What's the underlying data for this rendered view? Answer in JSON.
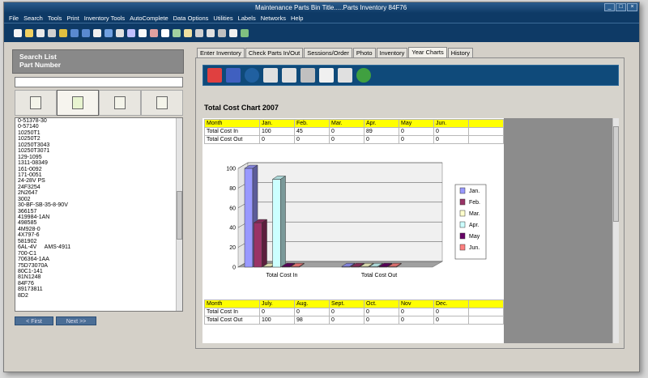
{
  "window": {
    "title": "Maintenance Parts Bin      Title.....Parts Inventory  84F76"
  },
  "menu": [
    "File",
    "Search",
    "Tools",
    "Print",
    "Inventory Tools",
    "AutoComplete",
    "Data Options",
    "Utilities",
    "Labels",
    "Networks",
    "Help"
  ],
  "toolbar_icons": [
    "new-icon",
    "open-icon",
    "save-icon",
    "print-icon",
    "edit-icon",
    "arrow-left-icon",
    "arrow-right-icon",
    "arrow-up-icon",
    "refresh-icon",
    "back-icon",
    "copy-icon",
    "paste-icon",
    "spell-icon",
    "search-icon",
    "link-icon",
    "notes-icon",
    "calendar-icon",
    "tools-icon",
    "settings-icon",
    "image-icon",
    "grid-icon"
  ],
  "search_list": {
    "title_line1": "Search List",
    "title_line2": "Part Number",
    "input_value": "",
    "button_icons": [
      "checklist-icon",
      "note-icon",
      "folder-icon",
      "hand-doc-icon"
    ],
    "items": [
      "0-51378-30",
      "0-57140",
      "10250T1",
      "10250T2",
      "10250T3043",
      "10250T3071",
      "129-1095",
      "1311-08349",
      "161-0092",
      "171-0051",
      "24-28V PS",
      "24F3254",
      "2N2647",
      "3002",
      "30-BF-SB-35-8-90V",
      "366157",
      "419984-1AN",
      "498585",
      "4M928-0",
      "4X797-6",
      "581902",
      "6AL-4V     AMS-4911",
      "700-C1",
      "706364-1AA",
      "75D73070A",
      "80C1-141",
      "81N1248",
      "84F76",
      "89173811",
      "8D2"
    ],
    "first_label": "< First",
    "next_label": "Next >>"
  },
  "tabs": [
    "Enter Inventory",
    "Check Parts In/Out",
    "Sessions/Order",
    "Photo",
    "Inventory",
    "Year Charts",
    "History"
  ],
  "active_tab": "Year Charts",
  "chart_toolbar_icons": [
    "bar-chart-color-icon",
    "bar-chart-blue-icon",
    "globe-icon",
    "pdf-icon",
    "recycle-icon",
    "eraser-icon",
    "email-icon",
    "printer-icon",
    "help-icon"
  ],
  "section_title": "Total Cost Chart  2007",
  "table_top": {
    "header": [
      "Month",
      "Jan.",
      "Feb.",
      "Mar.",
      "Apr.",
      "May",
      "Jun.",
      ""
    ],
    "rows": [
      [
        "Total Cost In",
        "100",
        "45",
        "0",
        "89",
        "0",
        "0",
        ""
      ],
      [
        "Total Cost Out",
        "0",
        "0",
        "0",
        "0",
        "0",
        "0",
        ""
      ]
    ]
  },
  "table_bottom": {
    "header": [
      "Month",
      "July.",
      "Aug.",
      "Sept.",
      "Oct.",
      "Nov",
      "Dec.",
      ""
    ],
    "rows": [
      [
        "Total Cost In",
        "0",
        "0",
        "0",
        "0",
        "0",
        "0",
        ""
      ],
      [
        "Total Cost Out",
        "100",
        "98",
        "0",
        "0",
        "0",
        "0",
        ""
      ]
    ]
  },
  "chart_data": {
    "type": "bar",
    "categories": [
      "Total Cost In",
      "Total Cost Out"
    ],
    "series": [
      {
        "name": "Jan.",
        "values": [
          100,
          0
        ],
        "color": "#9999ff"
      },
      {
        "name": "Feb.",
        "values": [
          45,
          0
        ],
        "color": "#993366"
      },
      {
        "name": "Mar.",
        "values": [
          0,
          0
        ],
        "color": "#ffffcc"
      },
      {
        "name": "Apr.",
        "values": [
          89,
          0
        ],
        "color": "#ccffff"
      },
      {
        "name": "May",
        "values": [
          0,
          0
        ],
        "color": "#660066"
      },
      {
        "name": "Jun.",
        "values": [
          0,
          0
        ],
        "color": "#ff8080"
      }
    ],
    "y_ticks": [
      "0",
      "20",
      "40",
      "60",
      "80",
      "100"
    ],
    "ylim": [
      0,
      100
    ],
    "grid": true,
    "legend": "right"
  }
}
